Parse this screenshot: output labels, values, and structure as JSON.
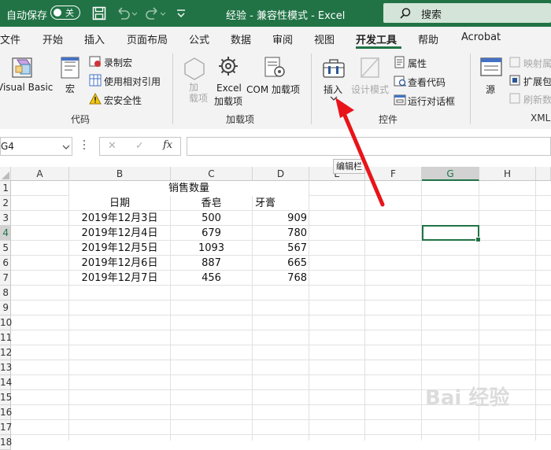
{
  "titlebar": {
    "autosave": "自动保存",
    "toggle": "关",
    "title": "经验 - 兼容性模式 - Excel",
    "search": "搜索"
  },
  "menu": [
    "文件",
    "开始",
    "插入",
    "页面布局",
    "公式",
    "数据",
    "审阅",
    "视图",
    "开发工具",
    "帮助",
    "Acrobat"
  ],
  "ribbon": {
    "code": {
      "visual_basic": "Visual Basic",
      "macro": "宏",
      "record": "录制宏",
      "relative": "使用相对引用",
      "security": "宏安全性",
      "group": "代码"
    },
    "addins": {
      "addin": "加\n载项",
      "excel_addin_1": "Excel",
      "excel_addin_2": "加载项",
      "com_addin_1": "COM 加载项",
      "group": "加载项"
    },
    "controls": {
      "insert": "插入",
      "design": "设计模式",
      "properties": "属性",
      "view_code": "查看代码",
      "run_dialog": "运行对话框",
      "group": "控件"
    },
    "xml": {
      "source": "源",
      "map_props": "映射属",
      "expand": "扩展包",
      "refresh": "刷新数",
      "group": "XML"
    }
  },
  "formula": {
    "namebox": "G4",
    "fx": "fx",
    "cancel": "✕",
    "enter": "✓"
  },
  "tooltip": "编辑栏",
  "columns": [
    "A",
    "B",
    "C",
    "D",
    "E",
    "F",
    "G",
    "H"
  ],
  "rows": [
    "1",
    "2",
    "3",
    "4",
    "5",
    "6",
    "7",
    "8",
    "9",
    "10",
    "11",
    "12",
    "13",
    "14",
    "15",
    "16",
    "17",
    "18"
  ],
  "sheet": {
    "title": "销售数量",
    "headers": [
      "日期",
      "香皂",
      "牙膏"
    ],
    "data": [
      [
        "2019年12月3日",
        "500",
        "909"
      ],
      [
        "2019年12月4日",
        "679",
        "780"
      ],
      [
        "2019年12月5日",
        "1093",
        "567"
      ],
      [
        "2019年12月6日",
        "887",
        "665"
      ],
      [
        "2019年12月7日",
        "456",
        "768"
      ]
    ]
  },
  "watermark": "Bai 经验",
  "colors": {
    "accent": "#217346",
    "arrow": "#e8141a"
  }
}
